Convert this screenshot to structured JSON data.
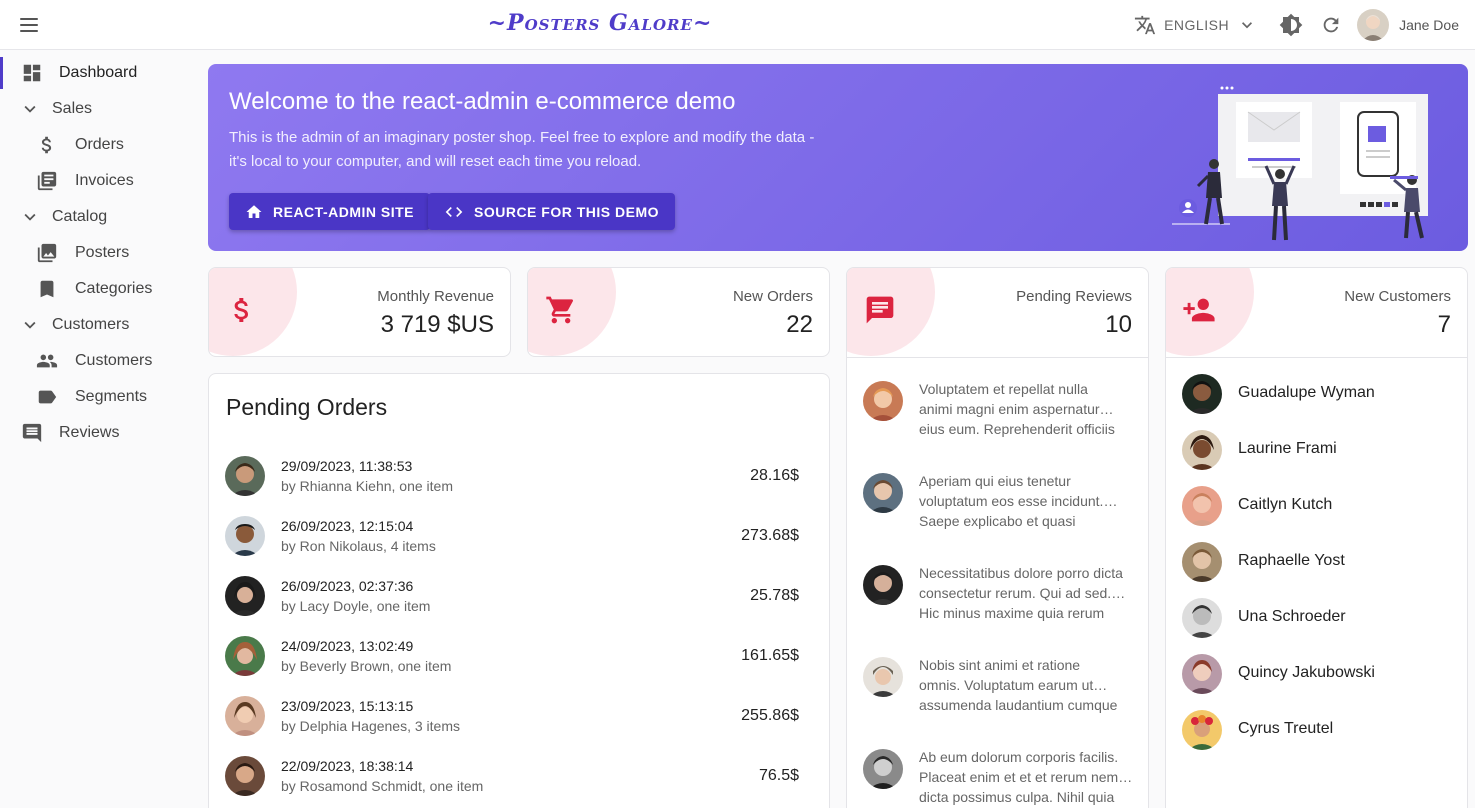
{
  "header": {
    "brand": "~Posters Galore~",
    "language": "ENGLISH",
    "user_name": "Jane Doe"
  },
  "sidebar": {
    "items": [
      {
        "label": "Dashboard",
        "icon": "dashboard-icon"
      },
      {
        "label": "Sales",
        "icon": "chevron-down-icon"
      },
      {
        "label": "Orders",
        "icon": "dollar-icon"
      },
      {
        "label": "Invoices",
        "icon": "invoice-icon"
      },
      {
        "label": "Catalog",
        "icon": "chevron-down-icon"
      },
      {
        "label": "Posters",
        "icon": "image-icon"
      },
      {
        "label": "Categories",
        "icon": "bookmark-icon"
      },
      {
        "label": "Customers",
        "icon": "chevron-down-icon"
      },
      {
        "label": "Customers",
        "icon": "people-icon"
      },
      {
        "label": "Segments",
        "icon": "label-icon"
      },
      {
        "label": "Reviews",
        "icon": "comment-icon"
      }
    ]
  },
  "welcome": {
    "title": "Welcome to the react-admin e-commerce demo",
    "line1": "This is the admin of an imaginary poster shop. Feel free to explore and modify the data -",
    "line2": "it's local to your computer, and will reset each time you reload.",
    "btn_site": "REACT-ADMIN SITE",
    "btn_source": "SOURCE FOR THIS DEMO"
  },
  "stats": {
    "revenue": {
      "label": "Monthly Revenue",
      "value": "3 719 $US"
    },
    "orders": {
      "label": "New Orders",
      "value": "22"
    },
    "reviews": {
      "label": "Pending Reviews",
      "value": "10"
    },
    "customers": {
      "label": "New Customers",
      "value": "7"
    }
  },
  "pending_orders": {
    "title": "Pending Orders",
    "rows": [
      {
        "date": "29/09/2023, 11:38:53",
        "who": "by Rhianna Kiehn, one item",
        "amount": "28.16$"
      },
      {
        "date": "26/09/2023, 12:15:04",
        "who": "by Ron Nikolaus, 4 items",
        "amount": "273.68$"
      },
      {
        "date": "26/09/2023, 02:37:36",
        "who": "by Lacy Doyle, one item",
        "amount": "25.78$"
      },
      {
        "date": "24/09/2023, 13:02:49",
        "who": "by Beverly Brown, one item",
        "amount": "161.65$"
      },
      {
        "date": "23/09/2023, 15:13:15",
        "who": "by Delphia Hagenes, 3 items",
        "amount": "255.86$"
      },
      {
        "date": "22/09/2023, 18:38:14",
        "who": "by Rosamond Schmidt, one item",
        "amount": "76.5$"
      }
    ]
  },
  "reviews": [
    {
      "l1": "Voluptatem et repellat nulla",
      "l2": "animi magni enim aspernatur…",
      "l3": "eius eum. Reprehenderit officiis"
    },
    {
      "l1": "Aperiam qui eius tenetur",
      "l2": "voluptatum eos esse incidunt.…",
      "l3": "Saepe explicabo et quasi"
    },
    {
      "l1": "Necessitatibus dolore porro dicta",
      "l2": "consectetur rerum. Qui ad sed.…",
      "l3": "Hic minus maxime quia rerum"
    },
    {
      "l1": "Nobis sint animi et ratione",
      "l2": "omnis. Voluptatum earum ut…",
      "l3": "assumenda laudantium cumque"
    },
    {
      "l1": "Ab eum dolorum corporis facilis.",
      "l2": "Placeat enim et et et rerum nem…",
      "l3": "dicta possimus culpa. Nihil quia"
    }
  ],
  "customers": [
    {
      "name": "Guadalupe Wyman"
    },
    {
      "name": "Laurine Frami"
    },
    {
      "name": "Caitlyn Kutch"
    },
    {
      "name": "Raphaelle Yost"
    },
    {
      "name": "Una Schroeder"
    },
    {
      "name": "Quincy Jakubowski"
    },
    {
      "name": "Cyrus Treutel"
    }
  ],
  "colors": {
    "accent": "#4f3cc9",
    "stat_icon": "#dc2440",
    "stat_blob": "#fce6ea"
  }
}
